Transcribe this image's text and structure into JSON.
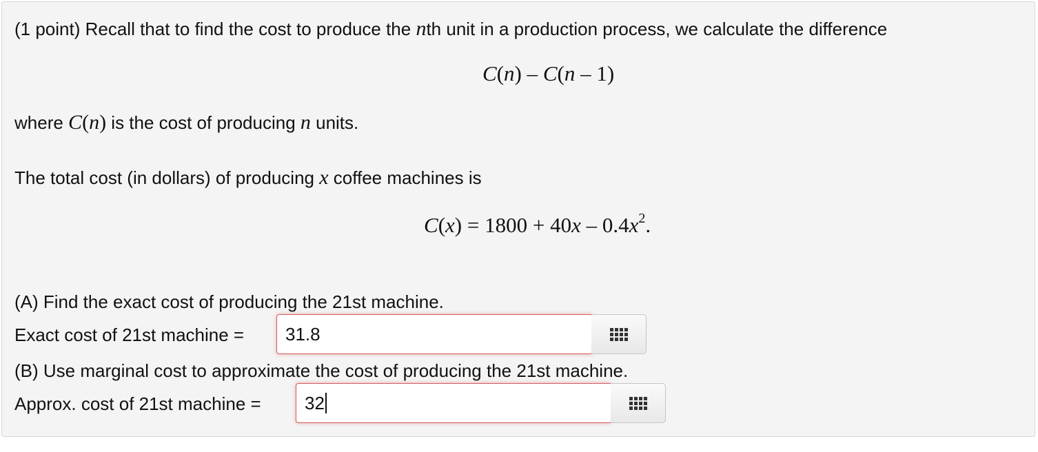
{
  "intro": {
    "prefix": "(1 point) Recall that to find the cost to produce the ",
    "n_var": "n",
    "suffix": "th unit in a production process, we calculate the difference"
  },
  "difference_formula": {
    "part1": "C",
    "part2": "(",
    "part3": "n",
    "part4": ") – ",
    "part5": "C",
    "part6": "(",
    "part7": "n",
    "part8": " – 1)"
  },
  "where_line": {
    "prefix": "where ",
    "cn_c": "C",
    "cn_open": "(",
    "cn_n": "n",
    "cn_close": ")",
    "middle": " is the cost of producing ",
    "n_var": "n",
    "suffix": " units."
  },
  "total_cost_line": {
    "prefix": "The total cost (in dollars) of producing ",
    "x_var": "x",
    "suffix": " coffee machines is"
  },
  "cost_formula": {
    "c": "C",
    "open": "(",
    "x1": "x",
    "close_eq": ") = 1800 + 40",
    "x2": "x",
    "minus": " – 0.4",
    "x3": "x",
    "exp": "2",
    "period": "."
  },
  "part_a": {
    "prompt": "(A) Find the exact cost of producing the 21st machine.",
    "label": "Exact cost of 21st machine =",
    "value": "31.8"
  },
  "part_b": {
    "prompt": "(B) Use marginal cost to approximate the cost of producing the 21st machine.",
    "label": "Approx. cost of 21st machine =",
    "value": "32"
  },
  "colors": {
    "panel_bg": "#f4f4f4",
    "error_border": "#d65a5a"
  },
  "icons": {
    "equation_palette": "keypad-grid-icon"
  }
}
